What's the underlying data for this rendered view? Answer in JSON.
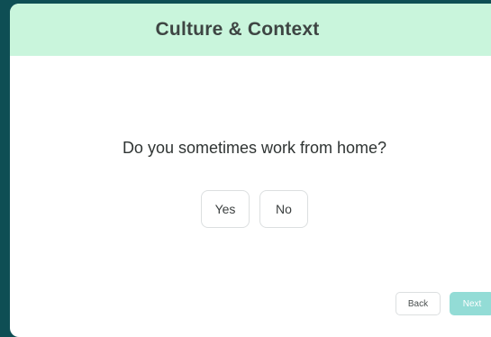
{
  "header": {
    "title": "Culture & Context"
  },
  "question": {
    "text": "Do you sometimes work from home?"
  },
  "answers": [
    {
      "label": "Yes"
    },
    {
      "label": "No"
    }
  ],
  "footer": {
    "back_label": "Back",
    "next_label": "Next",
    "next_state": "disabled"
  },
  "colors": {
    "background": "#0e4e54",
    "header_bg": "#c9f5dc",
    "next_button": "#93dcd6"
  }
}
